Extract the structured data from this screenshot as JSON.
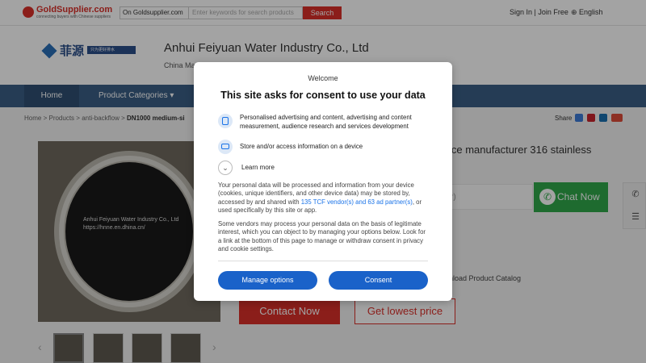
{
  "header": {
    "logo": "GoldSupplier.com",
    "logo_tagline": "connecting buyers with Chinese suppliers",
    "search_scope": "On Goldsupplier.com",
    "search_placeholder": "Enter keywords for search products",
    "search_button": "Search",
    "sign_in": "Sign In | Join Free",
    "language": "English"
  },
  "company": {
    "logo_cn": "菲源",
    "logo_slogan": "只为更好排水",
    "name": "Anhui Feiyuan Water Industry Co., Ltd",
    "subtitle": "China Ma                                                                             ainwater pump station ,Integrated sewage pumping s..."
  },
  "nav": {
    "home": "Home",
    "categories": "Product Categories"
  },
  "breadcrumb": {
    "items": [
      "Home",
      ">",
      "Products",
      ">",
      "anti-backflow",
      ">"
    ],
    "current": "DN1000 medium-si"
  },
  "share": {
    "label": "Share",
    "networks": [
      "twitter",
      "pinterest",
      "linkedin",
      "google-plus"
    ]
  },
  "product": {
    "watermark_line1": "Anhui Feiyuan Water Industry Co., Ltd",
    "watermark_line2": "https://hnne.en.dhina.cn/",
    "title_line1": "ice manufacturer 316 stainless",
    "title_line2": "",
    "price_tail": "r)",
    "chat_now": "Chat Now",
    "download_catalog": "nload Product Catalog",
    "contact_now": "Contact Now",
    "get_lowest_price": "Get lowest price"
  },
  "consent": {
    "brand": "Welcome",
    "title": "This site asks for consent to use your data",
    "purposes": [
      "Personalised advertising and content, advertising and content measurement, audience research and services development",
      "Store and/or access information on a device"
    ],
    "learn_more": "Learn more",
    "para1_before": "Your personal data will be processed and information from your device (cookies, unique identifiers, and other device data) may be stored by, accessed by and shared with ",
    "para1_link": "135 TCF vendor(s) and 63 ad partner(s)",
    "para1_after": ", or used specifically by this site or app.",
    "para2": "Some vendors may process your personal data on the basis of legitimate interest, which you can object to by managing your options below. Look for a link at the bottom of this page to manage or withdraw consent in privacy and cookie settings.",
    "manage_button": "Manage options",
    "consent_button": "Consent"
  },
  "colors": {
    "brand_red": "#d9302a",
    "nav_blue": "#3b5f86",
    "consent_blue": "#1a62c9",
    "chat_green": "#2fa84a"
  }
}
